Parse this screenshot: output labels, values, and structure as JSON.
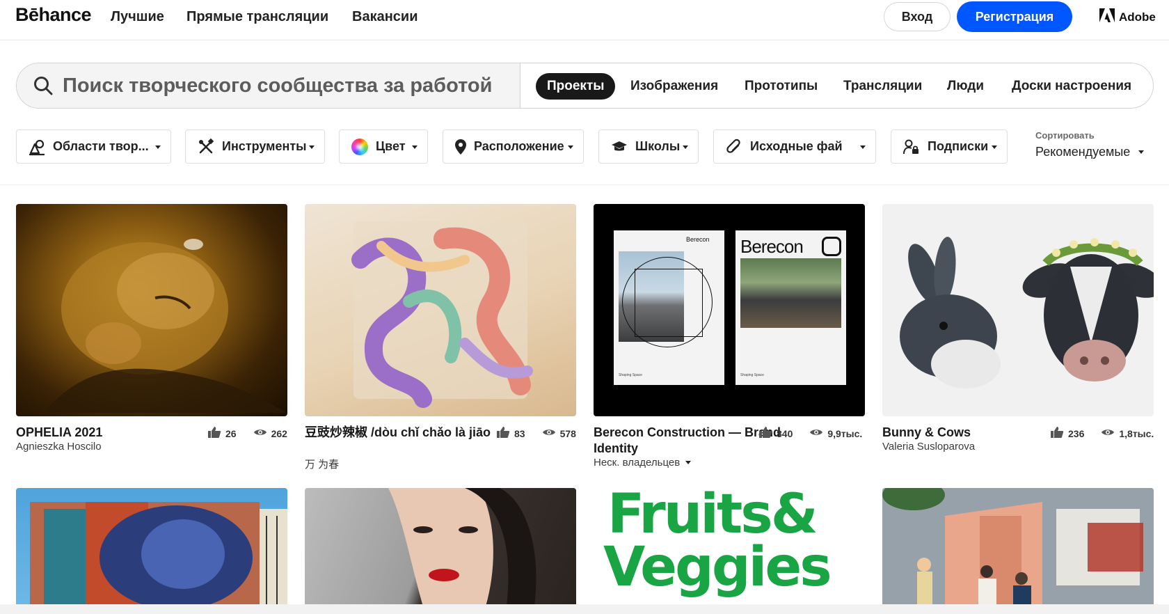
{
  "header": {
    "logo": "Bēhance",
    "nav": [
      "Лучшие",
      "Прямые трансляции",
      "Вакансии"
    ],
    "login_label": "Вход",
    "signup_label": "Регистрация",
    "adobe_label": "Adobe"
  },
  "search": {
    "placeholder": "Поиск творческого сообщества за работой",
    "value": "",
    "tabs": [
      "Проекты",
      "Изображения",
      "Прототипы",
      "Трансляции",
      "Люди",
      "Доски настроения"
    ],
    "active_tab": "Проекты"
  },
  "filters": [
    {
      "label": "Области твор...",
      "icon": "creative-fields-icon"
    },
    {
      "label": "Инструменты",
      "icon": "tools-icon"
    },
    {
      "label": "Цвет",
      "icon": "color-wheel-icon"
    },
    {
      "label": "Расположение",
      "icon": "location-pin-icon"
    },
    {
      "label": "Школы",
      "icon": "graduation-cap-icon"
    },
    {
      "label": "Исходные фай",
      "icon": "paperclip-icon"
    },
    {
      "label": "Подписки",
      "icon": "user-lock-icon"
    }
  ],
  "sort": {
    "label": "Сортировать",
    "value": "Рекомендуемые"
  },
  "projects": [
    {
      "title": "OPHELIA 2021",
      "owner": "Agnieszka Hoscilo",
      "likes": "26",
      "views": "262"
    },
    {
      "title": "豆豉炒辣椒 /dòu chǐ chǎo là jiāo",
      "owner": "万 为春",
      "likes": "83",
      "views": "578"
    },
    {
      "title": "Berecon Construction — Brand Identity",
      "owner": "Неск. владельцев",
      "likes": "840",
      "views": "9,9тыс."
    },
    {
      "title": "Bunny & Cows",
      "owner": "Valeria Susloparova",
      "likes": "236",
      "views": "1,8тыс."
    }
  ],
  "berecon": {
    "brand_small": "Berecon",
    "brand_large": "Berecon",
    "caption": "Shaping Space"
  },
  "fruits": {
    "line1": "Fruits&",
    "line2": "Veggies"
  },
  "colors": {
    "accent": "#0057ff",
    "text": "#191919",
    "active_tab_bg": "#191919"
  }
}
